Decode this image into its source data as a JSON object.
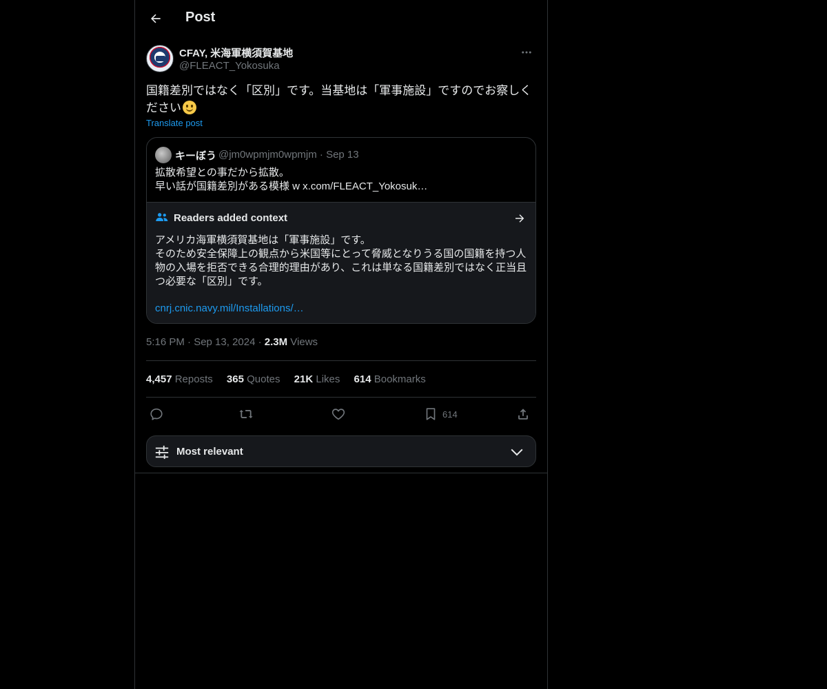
{
  "header": {
    "title": "Post"
  },
  "author": {
    "name": "CFAY, 米海軍横須賀基地",
    "handle": "@FLEACT_Yokosuka"
  },
  "post": {
    "text": "国籍差別ではなく「区別」です。当基地は「軍事施設」ですのでお察しください",
    "translate_label": "Translate post"
  },
  "quote": {
    "name": "キーぼう",
    "handle_date": "@jm0wpmjm0wpmjm · Sep 13",
    "line1": "拡散希望との事だから拡散。",
    "line2": "早い話が国籍差別がある模様 w x.com/FLEACT_Yokosuk…"
  },
  "context": {
    "title": "Readers added context",
    "line1": "アメリカ海軍横須賀基地は「軍事施設」です。",
    "line2": "そのため安全保障上の観点から米国等にとって脅威となりうる国の国籍を持つ人物の入場を拒否できる合理的理由があり、これは単なる国籍差別ではなく正当且つ必要な「区別」です。",
    "link": "cnrj.cnic.navy.mil/Installations/…"
  },
  "meta": {
    "time_date": "5:16 PM · Sep 13, 2024 · ",
    "views_count": "2.3M",
    "views_label": " Views"
  },
  "stats": [
    {
      "count": "4,457",
      "label": " Reposts"
    },
    {
      "count": "365",
      "label": " Quotes"
    },
    {
      "count": "21K",
      "label": " Likes"
    },
    {
      "count": "614",
      "label": " Bookmarks"
    }
  ],
  "actions": {
    "bookmark_count": "614"
  },
  "sort": {
    "label": "Most relevant"
  },
  "icons": {
    "back": "arrow-left-icon",
    "more": "more-horizontal-icon",
    "context": "people-icon",
    "context_arrow": "arrow-right-icon",
    "reply": "reply-icon",
    "repost": "repost-icon",
    "like": "heart-icon",
    "bookmark": "bookmark-icon",
    "share": "share-icon",
    "sort": "sliders-icon",
    "chevron": "chevron-down-icon"
  },
  "colors": {
    "background": "#000000",
    "text": "#e7e9ea",
    "muted": "#71767b",
    "accent": "#1d9bf0",
    "border": "#2f3336",
    "card": "#16181c"
  }
}
